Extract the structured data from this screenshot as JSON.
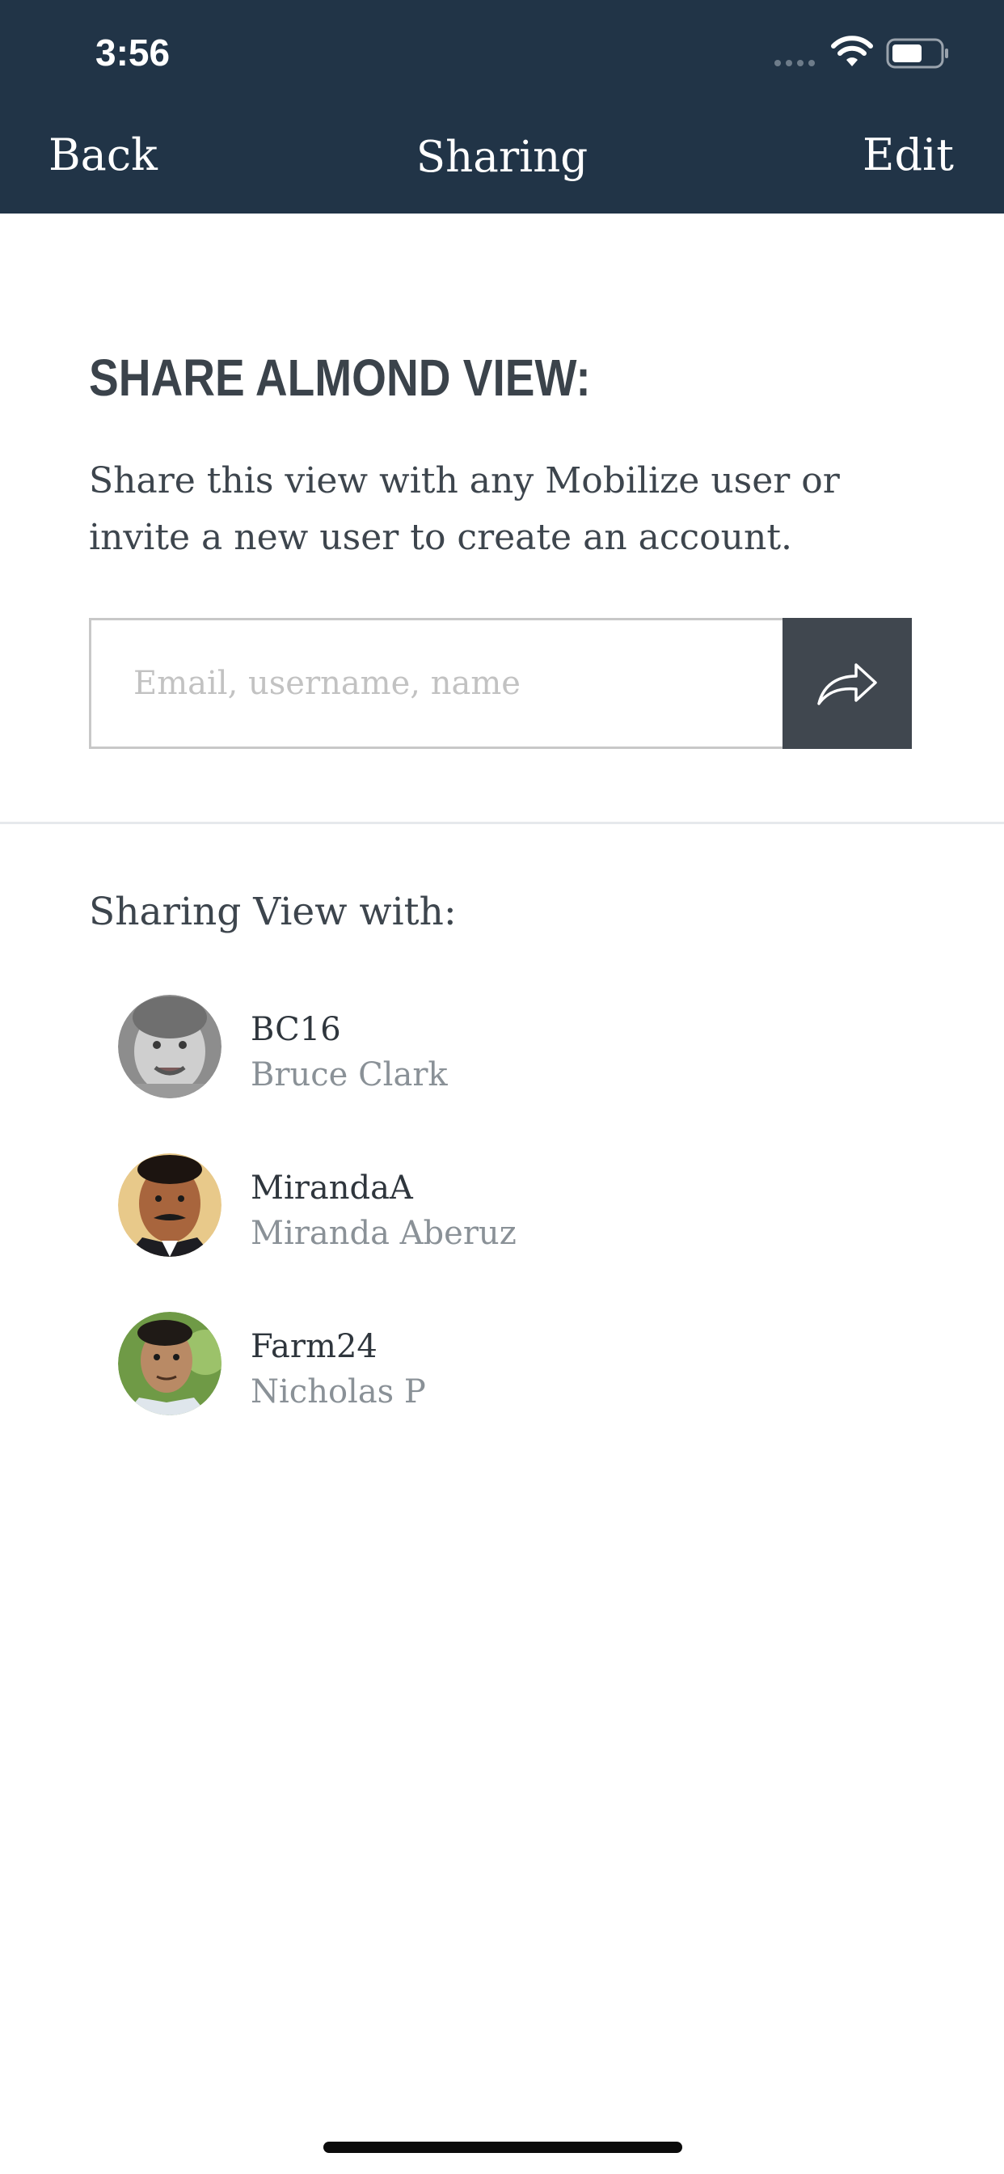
{
  "status_bar": {
    "time": "3:56"
  },
  "nav": {
    "back_label": "Back",
    "title": "Sharing",
    "edit_label": "Edit"
  },
  "share": {
    "heading": "SHARE ALMOND VIEW:",
    "description": "Share this view with any Mobilize user or invite a new user to create an account.",
    "input_placeholder": "Email, username, name",
    "input_value": "",
    "button_icon": "share-arrow-icon"
  },
  "sharing_list": {
    "label": "Sharing View with:",
    "users": [
      {
        "username": "BC16",
        "full_name": "Bruce Clark"
      },
      {
        "username": "MirandaA",
        "full_name": "Miranda Aberuz"
      },
      {
        "username": "Farm24",
        "full_name": "Nicholas P"
      }
    ]
  },
  "colors": {
    "header_bg": "#213447",
    "button_bg": "#40474f",
    "heading_text": "#3b434b",
    "secondary_text": "#8a9197"
  }
}
